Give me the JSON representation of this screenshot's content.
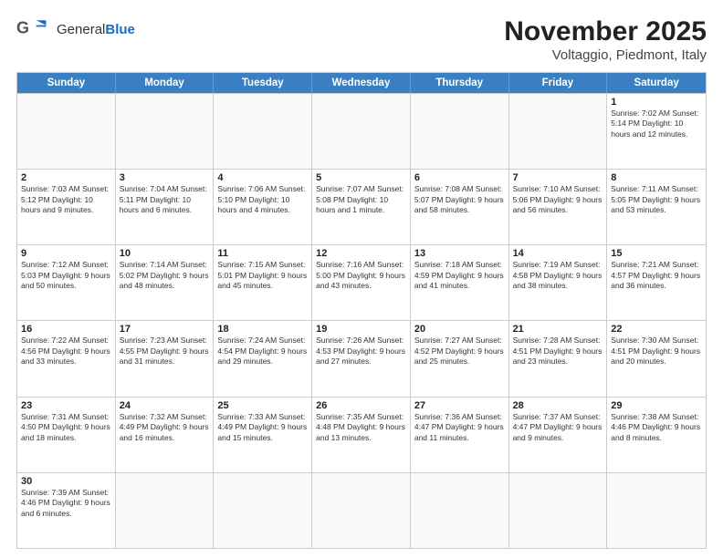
{
  "header": {
    "logo_text_general": "General",
    "logo_text_blue": "Blue",
    "title": "November 2025",
    "subtitle": "Voltaggio, Piedmont, Italy"
  },
  "weekdays": [
    "Sunday",
    "Monday",
    "Tuesday",
    "Wednesday",
    "Thursday",
    "Friday",
    "Saturday"
  ],
  "weeks": [
    [
      {
        "day": "",
        "info": ""
      },
      {
        "day": "",
        "info": ""
      },
      {
        "day": "",
        "info": ""
      },
      {
        "day": "",
        "info": ""
      },
      {
        "day": "",
        "info": ""
      },
      {
        "day": "",
        "info": ""
      },
      {
        "day": "1",
        "info": "Sunrise: 7:02 AM\nSunset: 5:14 PM\nDaylight: 10 hours\nand 12 minutes."
      }
    ],
    [
      {
        "day": "2",
        "info": "Sunrise: 7:03 AM\nSunset: 5:12 PM\nDaylight: 10 hours\nand 9 minutes."
      },
      {
        "day": "3",
        "info": "Sunrise: 7:04 AM\nSunset: 5:11 PM\nDaylight: 10 hours\nand 6 minutes."
      },
      {
        "day": "4",
        "info": "Sunrise: 7:06 AM\nSunset: 5:10 PM\nDaylight: 10 hours\nand 4 minutes."
      },
      {
        "day": "5",
        "info": "Sunrise: 7:07 AM\nSunset: 5:08 PM\nDaylight: 10 hours\nand 1 minute."
      },
      {
        "day": "6",
        "info": "Sunrise: 7:08 AM\nSunset: 5:07 PM\nDaylight: 9 hours\nand 58 minutes."
      },
      {
        "day": "7",
        "info": "Sunrise: 7:10 AM\nSunset: 5:06 PM\nDaylight: 9 hours\nand 56 minutes."
      },
      {
        "day": "8",
        "info": "Sunrise: 7:11 AM\nSunset: 5:05 PM\nDaylight: 9 hours\nand 53 minutes."
      }
    ],
    [
      {
        "day": "9",
        "info": "Sunrise: 7:12 AM\nSunset: 5:03 PM\nDaylight: 9 hours\nand 50 minutes."
      },
      {
        "day": "10",
        "info": "Sunrise: 7:14 AM\nSunset: 5:02 PM\nDaylight: 9 hours\nand 48 minutes."
      },
      {
        "day": "11",
        "info": "Sunrise: 7:15 AM\nSunset: 5:01 PM\nDaylight: 9 hours\nand 45 minutes."
      },
      {
        "day": "12",
        "info": "Sunrise: 7:16 AM\nSunset: 5:00 PM\nDaylight: 9 hours\nand 43 minutes."
      },
      {
        "day": "13",
        "info": "Sunrise: 7:18 AM\nSunset: 4:59 PM\nDaylight: 9 hours\nand 41 minutes."
      },
      {
        "day": "14",
        "info": "Sunrise: 7:19 AM\nSunset: 4:58 PM\nDaylight: 9 hours\nand 38 minutes."
      },
      {
        "day": "15",
        "info": "Sunrise: 7:21 AM\nSunset: 4:57 PM\nDaylight: 9 hours\nand 36 minutes."
      }
    ],
    [
      {
        "day": "16",
        "info": "Sunrise: 7:22 AM\nSunset: 4:56 PM\nDaylight: 9 hours\nand 33 minutes."
      },
      {
        "day": "17",
        "info": "Sunrise: 7:23 AM\nSunset: 4:55 PM\nDaylight: 9 hours\nand 31 minutes."
      },
      {
        "day": "18",
        "info": "Sunrise: 7:24 AM\nSunset: 4:54 PM\nDaylight: 9 hours\nand 29 minutes."
      },
      {
        "day": "19",
        "info": "Sunrise: 7:26 AM\nSunset: 4:53 PM\nDaylight: 9 hours\nand 27 minutes."
      },
      {
        "day": "20",
        "info": "Sunrise: 7:27 AM\nSunset: 4:52 PM\nDaylight: 9 hours\nand 25 minutes."
      },
      {
        "day": "21",
        "info": "Sunrise: 7:28 AM\nSunset: 4:51 PM\nDaylight: 9 hours\nand 23 minutes."
      },
      {
        "day": "22",
        "info": "Sunrise: 7:30 AM\nSunset: 4:51 PM\nDaylight: 9 hours\nand 20 minutes."
      }
    ],
    [
      {
        "day": "23",
        "info": "Sunrise: 7:31 AM\nSunset: 4:50 PM\nDaylight: 9 hours\nand 18 minutes."
      },
      {
        "day": "24",
        "info": "Sunrise: 7:32 AM\nSunset: 4:49 PM\nDaylight: 9 hours\nand 16 minutes."
      },
      {
        "day": "25",
        "info": "Sunrise: 7:33 AM\nSunset: 4:49 PM\nDaylight: 9 hours\nand 15 minutes."
      },
      {
        "day": "26",
        "info": "Sunrise: 7:35 AM\nSunset: 4:48 PM\nDaylight: 9 hours\nand 13 minutes."
      },
      {
        "day": "27",
        "info": "Sunrise: 7:36 AM\nSunset: 4:47 PM\nDaylight: 9 hours\nand 11 minutes."
      },
      {
        "day": "28",
        "info": "Sunrise: 7:37 AM\nSunset: 4:47 PM\nDaylight: 9 hours\nand 9 minutes."
      },
      {
        "day": "29",
        "info": "Sunrise: 7:38 AM\nSunset: 4:46 PM\nDaylight: 9 hours\nand 8 minutes."
      }
    ],
    [
      {
        "day": "30",
        "info": "Sunrise: 7:39 AM\nSunset: 4:46 PM\nDaylight: 9 hours\nand 6 minutes."
      },
      {
        "day": "",
        "info": ""
      },
      {
        "day": "",
        "info": ""
      },
      {
        "day": "",
        "info": ""
      },
      {
        "day": "",
        "info": ""
      },
      {
        "day": "",
        "info": ""
      },
      {
        "day": "",
        "info": ""
      }
    ]
  ]
}
